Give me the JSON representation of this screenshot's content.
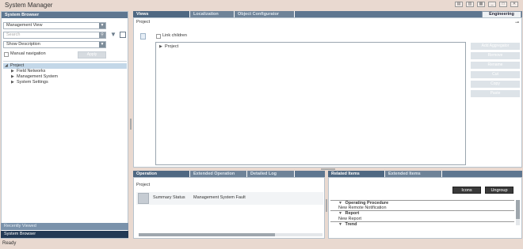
{
  "app": {
    "title": "System Manager",
    "status": "Ready"
  },
  "browser": {
    "header": "System Browser",
    "view_select": "Management View",
    "search_placeholder": "Search",
    "description_select": "Show Description",
    "manual_nav_label": "Manual navigation",
    "apply_label": "Apply",
    "tree": [
      {
        "label": "Project",
        "level": 0,
        "expanded": true
      },
      {
        "label": "Field Networks",
        "level": 1,
        "expanded": false
      },
      {
        "label": "Management System",
        "level": 1,
        "expanded": false
      },
      {
        "label": "System Settings",
        "level": 1,
        "expanded": false
      }
    ],
    "recent_views": "Recently Viewed",
    "footer": "System Browser"
  },
  "main": {
    "tabs": [
      "Views",
      "Localization",
      "Object Configurator"
    ],
    "engineering_label": "Engineering",
    "project_label": "Project",
    "link_children_label": "Link children",
    "inner_tree_root": "Project",
    "side_buttons": [
      "Add Aggregator",
      "Remove",
      "Rename",
      "Cut",
      "Copy",
      "Paste"
    ]
  },
  "operation": {
    "tabs": [
      "Operation",
      "Extended Operation",
      "Detailed Log"
    ],
    "project_label": "Project",
    "summary_label": "Summary Status",
    "summary_value": "Management System Fault"
  },
  "related": {
    "tabs": [
      "Related Items",
      "Extended Items"
    ],
    "icons_button": "Icons",
    "ungroup_button": "Ungroup",
    "groups": [
      {
        "title": "Operating Procedure",
        "item": "New Remote Notification"
      },
      {
        "title": "Report",
        "item": "New Report"
      },
      {
        "title": "Trend",
        "item": ""
      }
    ]
  }
}
